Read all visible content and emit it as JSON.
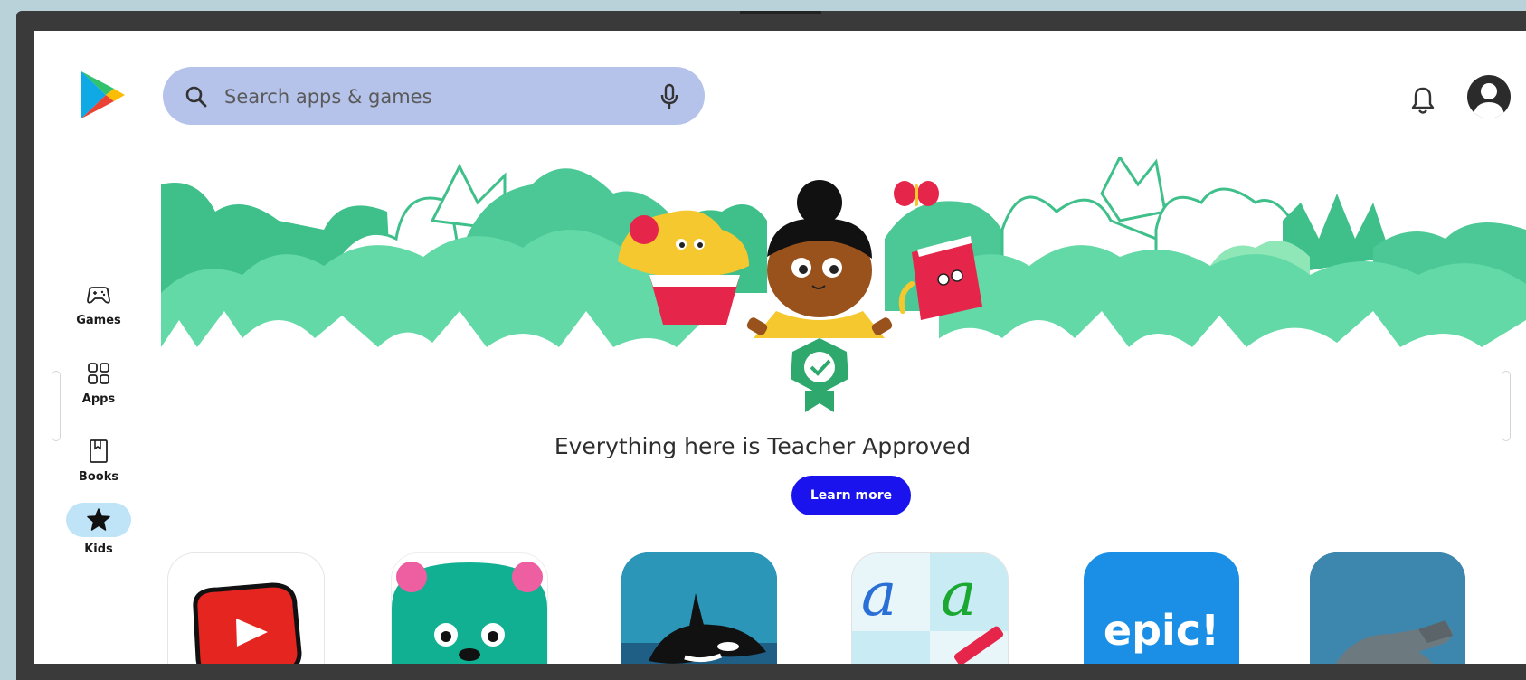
{
  "search": {
    "placeholder": "Search apps & games"
  },
  "nav": {
    "games": "Games",
    "apps": "Apps",
    "books": "Books",
    "kids": "Kids"
  },
  "promo": {
    "headline": "Everything here is Teacher Approved",
    "button": "Learn more"
  },
  "apps": [
    {
      "icon": "youtube-kids-icon"
    },
    {
      "icon": "green-bear-icon"
    },
    {
      "icon": "orca-ocean-icon"
    },
    {
      "icon": "cursive-letters-icon"
    },
    {
      "icon": "epic-logo-icon",
      "text": "epic!"
    },
    {
      "icon": "dinosaur-icon"
    }
  ],
  "colors": {
    "search_bg": "#b5c2ea",
    "kids_pill": "#bfe3f7",
    "learn_button": "#1a13ee",
    "banner_green": "#62d9a6",
    "epic_blue": "#1a8fe5"
  }
}
